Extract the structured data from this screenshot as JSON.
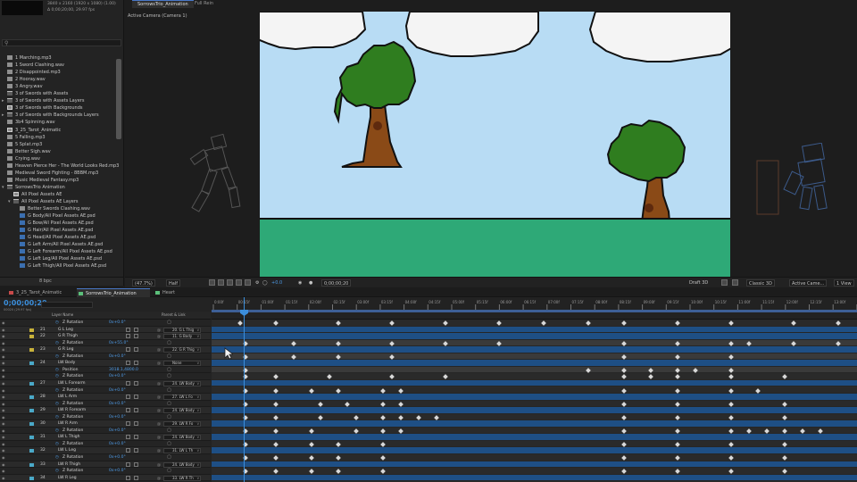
{
  "project": {
    "file_info": [
      "3840 x 2160 (1920 x 1080) (1.00)",
      "Δ 0;00;20;00, 29.97 fps"
    ],
    "items": [
      {
        "label": "1 Marching.mp3",
        "type": "audio",
        "indent": 0
      },
      {
        "label": "1 Sword Clashing.wav",
        "type": "audio",
        "indent": 0
      },
      {
        "label": "2 Disappointed.mp3",
        "type": "audio",
        "indent": 0
      },
      {
        "label": "2 Hooray.wav",
        "type": "audio",
        "indent": 0
      },
      {
        "label": "3 Angry.wav",
        "type": "audio",
        "indent": 0
      },
      {
        "label": "3 of Swords with Assets",
        "type": "folder",
        "indent": 0
      },
      {
        "label": "3 of Swords with Assets Layers",
        "type": "folder",
        "indent": 0,
        "twirl": ">"
      },
      {
        "label": "3 of Swords with Backgrounds",
        "type": "comp",
        "indent": 0
      },
      {
        "label": "3 of Swords with Backgrounds Layers",
        "type": "folder",
        "indent": 0,
        "twirl": ">"
      },
      {
        "label": "3b4 Spinning.wav",
        "type": "audio",
        "indent": 0
      },
      {
        "label": "3_25_Tarot_Animatic",
        "type": "comp",
        "indent": 0
      },
      {
        "label": "5 Falling.mp3",
        "type": "audio",
        "indent": 0
      },
      {
        "label": "5 Splat.mp3",
        "type": "audio",
        "indent": 0
      },
      {
        "label": "Better Sigh.wav",
        "type": "audio",
        "indent": 0
      },
      {
        "label": "Crying.wav",
        "type": "audio",
        "indent": 0
      },
      {
        "label": "Heaven Pierce Her - The World Looks Red.mp3",
        "type": "audio",
        "indent": 0
      },
      {
        "label": "Medieval Sword Fighting - 8BBM.mp3",
        "type": "audio",
        "indent": 0
      },
      {
        "label": "Music Medieval Fantasy.mp3",
        "type": "audio",
        "indent": 0
      },
      {
        "label": "SorrowsTrio Animation",
        "type": "folder",
        "indent": 0,
        "twirl": "v"
      },
      {
        "label": "All Pixel Assets AE",
        "type": "comp",
        "indent": 1
      },
      {
        "label": "All Pixel Assets AE Layers",
        "type": "folder",
        "indent": 1,
        "twirl": "v"
      },
      {
        "label": "Better Swords Clashing.wav",
        "type": "audio",
        "indent": 2
      },
      {
        "label": "G Body/All Pixel Assets AE.psd",
        "type": "psd",
        "indent": 2
      },
      {
        "label": "G Bow/All Pixel Assets AE.psd",
        "type": "psd",
        "indent": 2
      },
      {
        "label": "G Hair/All Pixel Assets AE.psd",
        "type": "psd",
        "indent": 2
      },
      {
        "label": "G Head/All Pixel Assets AE.psd",
        "type": "psd",
        "indent": 2
      },
      {
        "label": "G Left Arm/All Pixel Assets AE.psd",
        "type": "psd",
        "indent": 2
      },
      {
        "label": "G Left Forearm/All Pixel Assets AE.psd",
        "type": "psd",
        "indent": 2
      },
      {
        "label": "G Left Leg/All Pixel Assets AE.psd",
        "type": "psd",
        "indent": 2
      },
      {
        "label": "G Left Thigh/All Pixel Assets AE.psd",
        "type": "psd",
        "indent": 2
      }
    ],
    "bottom": {
      "bpc": "8 bpc"
    }
  },
  "comp_panel": {
    "tabs": [
      "SorrowsTrio_Animation",
      "Full Rein"
    ],
    "camera_label": "Active Camera (Camera 1)",
    "toolbar": {
      "magnification": "(47.7%)",
      "resolution": "Half",
      "exposure": "+0.0",
      "current_time": "0;00;00;20",
      "draft": "Draft 3D",
      "renderer": "Classic 3D",
      "view": "Active Came...",
      "views": "1 View"
    }
  },
  "timeline": {
    "tabs": [
      {
        "label": "3_25_Tarot_Animatic",
        "color": "#c84a4a",
        "active": false
      },
      {
        "label": "SorrowsTrio_Animation",
        "color": "#5bbf7a",
        "active": true
      },
      {
        "label": "Heart",
        "color": "#5bbf7a",
        "active": false
      }
    ],
    "timecode": "0;00;00;20",
    "frames": "00020 (29.97 fps)",
    "headers": {
      "layer_name": "Layer Name",
      "parent": "Parent & Link"
    },
    "ruler_labels": [
      "0:00f",
      "00:15f",
      "01:00f",
      "01:15f",
      "02:00f",
      "02:15f",
      "03:00f",
      "03:15f",
      "04:00f",
      "04:15f",
      "05:00f",
      "05:15f",
      "06:00f",
      "06:15f",
      "07:00f",
      "07:15f",
      "08:00f",
      "08:15f",
      "09:00f",
      "09:15f",
      "10:00f",
      "10:15f",
      "11:00f",
      "11:15f",
      "12:00f",
      "12:15f",
      "13:00f",
      "13:15f"
    ],
    "rows": [
      {
        "kind": "prop",
        "name": "Z Rotation",
        "value": "0x+0.0°",
        "keys": [
          30,
          70,
          140,
          200,
          260,
          320,
          370,
          420,
          460,
          520,
          580,
          650,
          700
        ]
      },
      {
        "kind": "layer",
        "num": "21",
        "name": "G L Leg",
        "color": "#c8b23a",
        "parent": "20. G L Thig",
        "keys": []
      },
      {
        "kind": "layer",
        "num": "22",
        "name": "G R Thigh",
        "color": "#c8b23a",
        "parent": "11. G Body",
        "keys": []
      },
      {
        "kind": "prop",
        "name": "Z Rotation",
        "value": "0x+55.0°",
        "keys": [
          36,
          90,
          140,
          200,
          260,
          320,
          460,
          520,
          580,
          600,
          650,
          700
        ]
      },
      {
        "kind": "layer",
        "num": "23",
        "name": "G R Leg",
        "color": "#c8b23a",
        "parent": "22. G R Thig",
        "keys": []
      },
      {
        "kind": "prop",
        "name": "Z Rotation",
        "value": "0x+0.0°",
        "keys": [
          36,
          90,
          140,
          200,
          460,
          520,
          580
        ]
      },
      {
        "kind": "layer",
        "num": "24",
        "name": "LW Body",
        "color": "#4aa9c8",
        "parent": "None",
        "keys": []
      },
      {
        "kind": "prop",
        "name": "Position",
        "value": "3018.1,4800.0",
        "keys": [
          36,
          420,
          460,
          490,
          520,
          540,
          580
        ]
      },
      {
        "kind": "prop",
        "name": "Z Rotation",
        "value": "0x+0.0°",
        "keys": [
          36,
          70,
          130,
          200,
          260,
          460,
          490,
          520,
          580,
          640
        ]
      },
      {
        "kind": "layer",
        "num": "27",
        "name": "LW L Forearm",
        "color": "#4aa9c8",
        "parent": "24. LW Body",
        "keys": []
      },
      {
        "kind": "prop",
        "name": "Z Rotation",
        "value": "0x+0.0°",
        "keys": [
          36,
          70,
          110,
          140,
          190,
          210,
          460,
          520,
          580,
          610
        ]
      },
      {
        "kind": "layer",
        "num": "28",
        "name": "LW L Arm",
        "color": "#4aa9c8",
        "parent": "27. LW L Fo",
        "keys": []
      },
      {
        "kind": "prop",
        "name": "Z Rotation",
        "value": "0x+0.0°",
        "keys": [
          36,
          70,
          120,
          150,
          190,
          210,
          460,
          520,
          580,
          640
        ]
      },
      {
        "kind": "layer",
        "num": "29",
        "name": "LW R Forearm",
        "color": "#4aa9c8",
        "parent": "24. LW Body",
        "keys": []
      },
      {
        "kind": "prop",
        "name": "Z Rotation",
        "value": "0x+0.0°",
        "keys": [
          36,
          70,
          120,
          160,
          190,
          210,
          230,
          250,
          460,
          520,
          580,
          640
        ]
      },
      {
        "kind": "layer",
        "num": "30",
        "name": "LW R Arm",
        "color": "#4aa9c8",
        "parent": "29. LW R Fo",
        "keys": []
      },
      {
        "kind": "prop",
        "name": "Z Rotation",
        "value": "0x+0.0°",
        "keys": [
          36,
          70,
          110,
          160,
          190,
          210,
          460,
          520,
          580,
          600,
          620,
          640,
          660,
          680
        ]
      },
      {
        "kind": "layer",
        "num": "31",
        "name": "LW L Thigh",
        "color": "#4aa9c8",
        "parent": "24. LW Body",
        "keys": []
      },
      {
        "kind": "prop",
        "name": "Z Rotation",
        "value": "0x+0.0°",
        "keys": [
          36,
          70,
          110,
          140,
          190,
          460,
          520,
          580,
          640
        ]
      },
      {
        "kind": "layer",
        "num": "32",
        "name": "LW L Leg",
        "color": "#4aa9c8",
        "parent": "31. LW L Th",
        "keys": []
      },
      {
        "kind": "prop",
        "name": "Z Rotation",
        "value": "0x+0.0°",
        "keys": [
          36,
          70,
          110,
          140,
          190,
          460,
          520,
          580,
          640
        ]
      },
      {
        "kind": "layer",
        "num": "33",
        "name": "LW R Thigh",
        "color": "#4aa9c8",
        "parent": "24. LW Body",
        "keys": []
      },
      {
        "kind": "prop",
        "name": "Z Rotation",
        "value": "0x+0.0°",
        "keys": [
          36,
          70,
          110,
          140,
          190,
          460,
          520,
          580,
          640
        ]
      },
      {
        "kind": "layer",
        "num": "34",
        "name": "LW R Leg",
        "color": "#4aa9c8",
        "parent": "33. LW R Th",
        "keys": []
      }
    ]
  },
  "colors": {
    "accent": "#3b8edb",
    "sky": "#b8dcf4",
    "grass": "#2ea977",
    "leaves": "#2f7d1f",
    "trunk": "#8a4a17"
  }
}
